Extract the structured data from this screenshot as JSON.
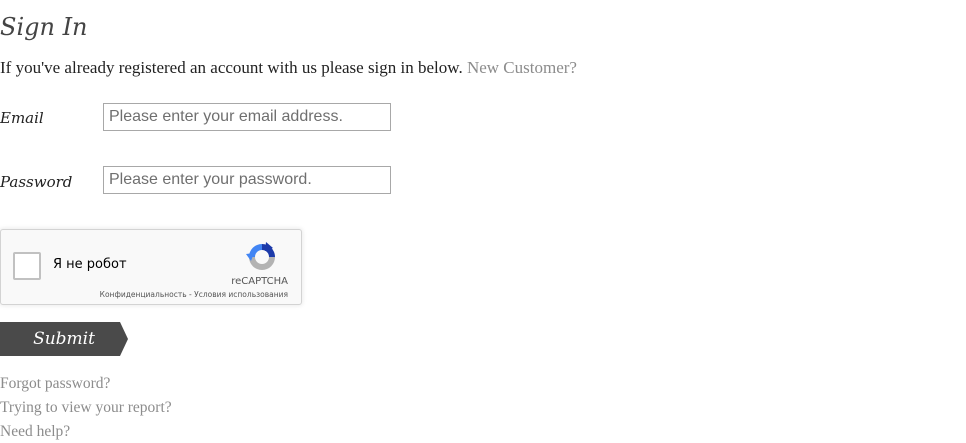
{
  "page": {
    "title": "Sign In",
    "intro_text": "If you've already registered an account with us please sign in below.",
    "new_customer_link": "New Customer?"
  },
  "form": {
    "email_label": "Email",
    "email_placeholder": "Please enter your email address.",
    "email_value": "",
    "password_label": "Password",
    "password_placeholder": "Please enter your password.",
    "password_value": "",
    "submit_label": "Submit"
  },
  "recaptcha": {
    "checkbox_label": "Я не робот",
    "brand": "reCAPTCHA",
    "privacy_link": "Конфиденциальность",
    "separator": " - ",
    "terms_link": "Условия использования",
    "checked": false
  },
  "links": {
    "forgot_password": "Forgot password?",
    "view_report": "Trying to view your report?",
    "need_help": "Need help?"
  },
  "colors": {
    "link_gray": "#8c8c8c",
    "button_bg": "#4a4a4a",
    "input_border": "#a8a8a8",
    "recaptcha_blue": "#1c3aa9",
    "recaptcha_light_blue": "#4285f4",
    "recaptcha_gray": "#b3b3b3"
  }
}
